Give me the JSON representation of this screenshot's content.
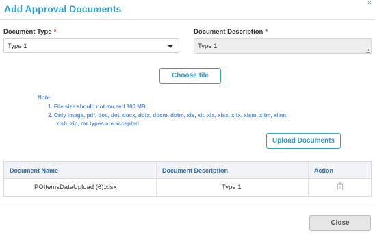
{
  "dialog": {
    "title": "Add Approval Documents",
    "close_icon": "close-icon"
  },
  "form": {
    "document_type_label": "Document Type",
    "document_type_required": "*",
    "document_type_value": "Type 1",
    "document_description_label": "Document Description",
    "document_description_required": "*",
    "document_description_value": "Type 1"
  },
  "buttons": {
    "choose_file": "Choose file",
    "upload_documents": "Upload Documents",
    "close": "Close"
  },
  "note": {
    "title": "Note:",
    "items": [
      "1. File size should not exceed 100 MB",
      "2. Only image, pdf, doc, dot, docx, dotx, docm, dotm, xls, xlt, xla, xlsx, xltx, xlsm, xltm, xlam,",
      "xlsb, zip, rar types are accepted."
    ]
  },
  "table": {
    "headers": [
      "Document Name",
      "Document Description",
      "Action"
    ],
    "rows": [
      {
        "name": "POItemsDataUpload (6).xlsx",
        "description": "Type 1",
        "action_icon": "trash-icon"
      }
    ]
  },
  "colors": {
    "accent": "#2aa3d6",
    "note": "#5a8fe0",
    "header_text": "#2a6fb5",
    "required": "#e23b3b"
  }
}
